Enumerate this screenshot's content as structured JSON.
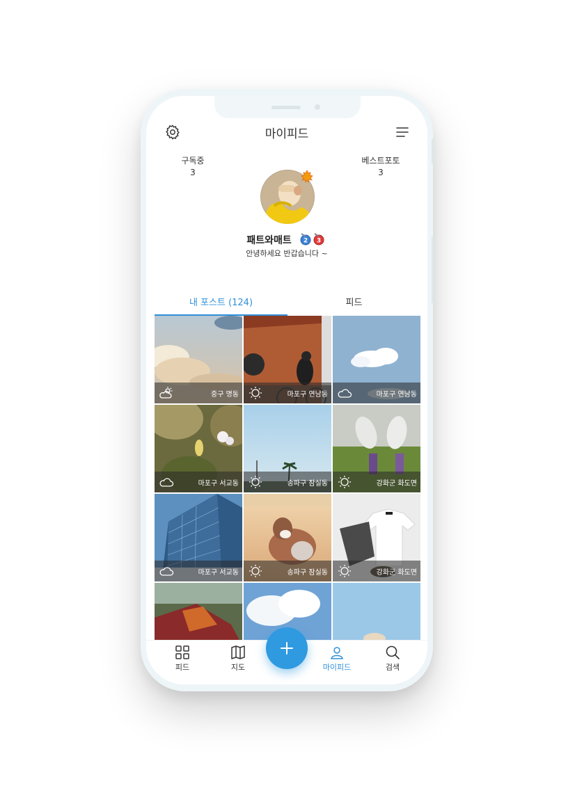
{
  "header": {
    "title": "마이피드"
  },
  "stats": {
    "left": {
      "label": "구독중",
      "value": "3"
    },
    "right": {
      "label": "베스트포토",
      "value": "3"
    }
  },
  "profile": {
    "name": "패트와매트",
    "badges": [
      "2",
      "3"
    ],
    "bio": "안녕하세요 반갑습니다 ~"
  },
  "tabs": [
    {
      "label": "내 포스트 (124)",
      "active": true
    },
    {
      "label": "피드",
      "active": false
    }
  ],
  "posts": [
    {
      "location": "중구 명동",
      "weather": "partly-cloudy-icon"
    },
    {
      "location": "마포구 연남동",
      "weather": "sun-icon"
    },
    {
      "location": "마포구 연남동",
      "weather": "cloud-icon"
    },
    {
      "location": "마포구 서교동",
      "weather": "cloud-icon"
    },
    {
      "location": "송파구 잠실동",
      "weather": "sun-icon"
    },
    {
      "location": "강화군 화도면",
      "weather": "sun-icon"
    },
    {
      "location": "마포구 서교동",
      "weather": "cloud-icon"
    },
    {
      "location": "송파구 잠실동",
      "weather": "sun-icon"
    },
    {
      "location": "강화군 화도면",
      "weather": "sun-icon"
    },
    {
      "location": "",
      "weather": ""
    },
    {
      "location": "",
      "weather": ""
    },
    {
      "location": "",
      "weather": ""
    }
  ],
  "bottom_nav": [
    {
      "label": "피드",
      "icon": "grid-icon"
    },
    {
      "label": "지도",
      "icon": "map-icon"
    },
    {
      "label": "마이피드",
      "icon": "person-icon",
      "active": true
    },
    {
      "label": "검색",
      "icon": "search-icon"
    }
  ],
  "colors": {
    "accent": "#2f8fd8",
    "fab": "#2f9ae0"
  }
}
